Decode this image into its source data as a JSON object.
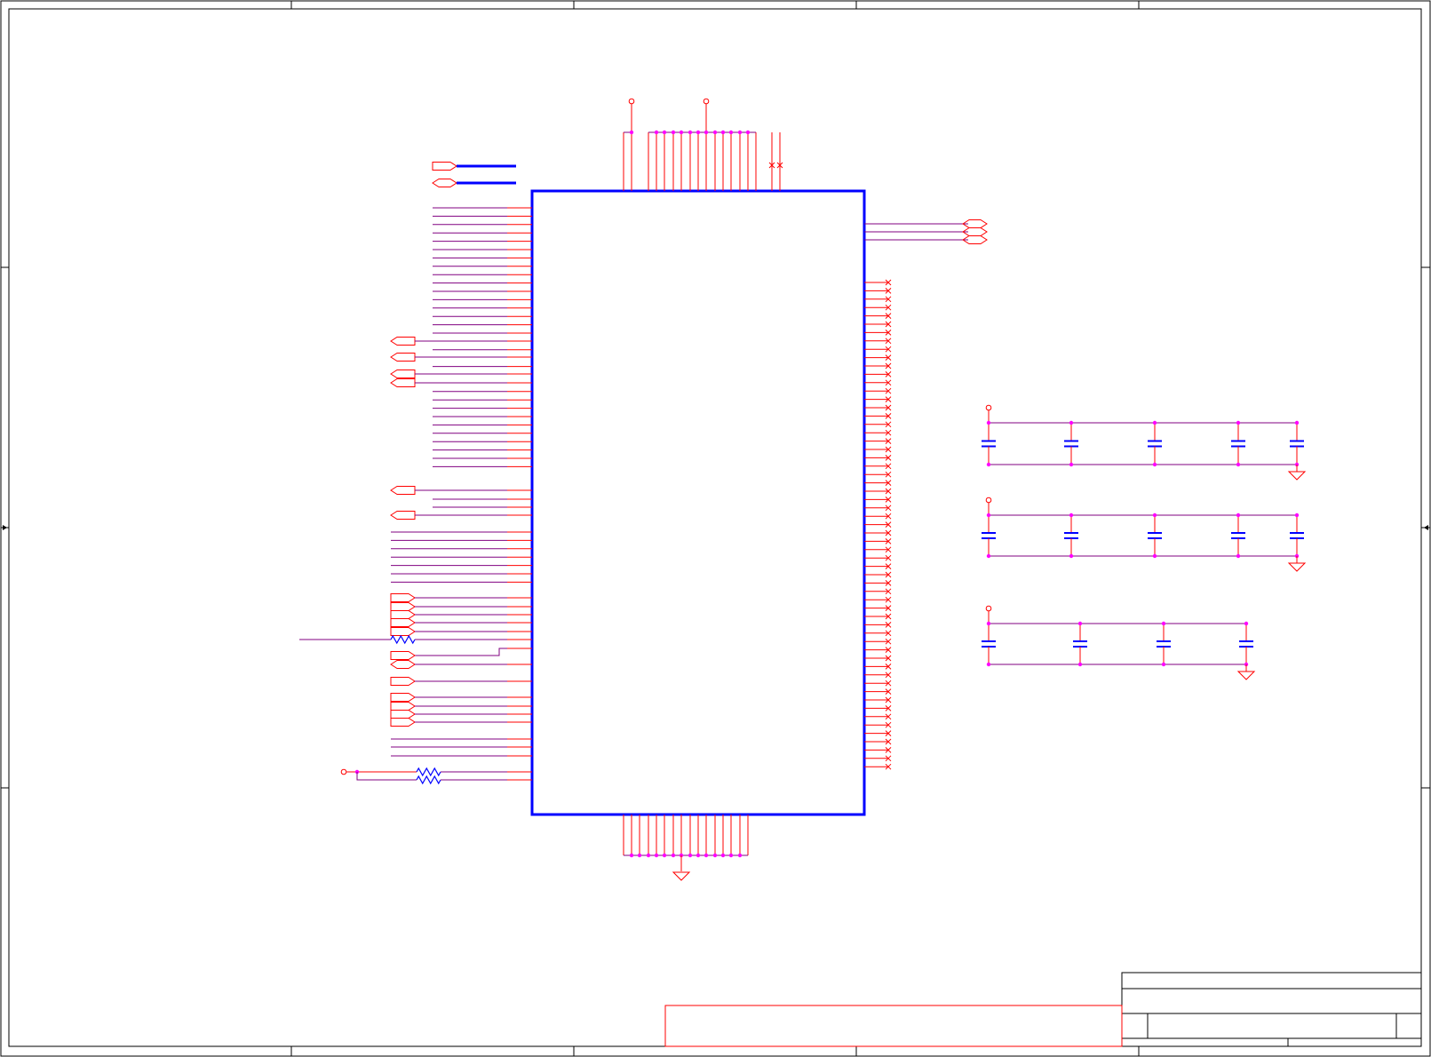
{
  "sheet": {
    "kind": "schematic",
    "colors": {
      "border": "#000000",
      "pin": "#ff0000",
      "wire": "#800080",
      "bus": "#0000ff",
      "component": "#0000ff",
      "junction": "#ff00ff"
    },
    "grid_columns": 5,
    "grid_rows": 4
  },
  "main_ic": {
    "top_pins": 20,
    "bottom_pins": 17,
    "left_pins": 81,
    "right_pins_unconnected": 70,
    "right_port_pins": 3
  },
  "left_ports": {
    "bus_ports": 2,
    "input_ports": 12,
    "output_ports": 6,
    "series_resistors": 3
  },
  "decoupling_banks": [
    {
      "capacitors": 5
    },
    {
      "capacitors": 5
    },
    {
      "capacitors": 4
    }
  ],
  "title_block": {
    "title": "",
    "size": "",
    "document_number": "",
    "rev": "",
    "date": "",
    "sheet": ""
  }
}
